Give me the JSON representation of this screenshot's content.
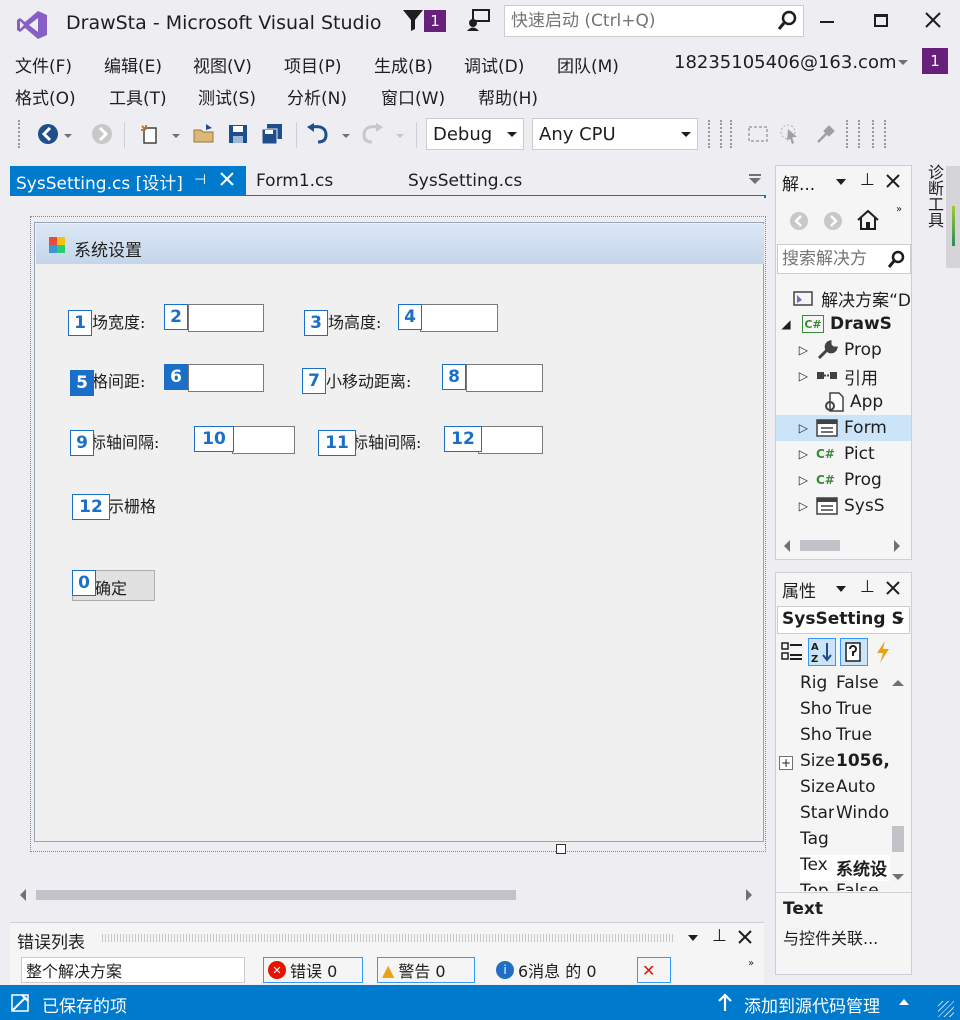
{
  "window": {
    "app_title": "DrawSta - Microsoft Visual Studio",
    "notification_count": "1",
    "quick_launch_placeholder": "快速启动 (Ctrl+Q)"
  },
  "menu_row1": [
    "文件(F)",
    "编辑(E)",
    "视图(V)",
    "项目(P)",
    "生成(B)",
    "调试(D)",
    "团队(M)"
  ],
  "menu_row2": [
    "格式(O)",
    "工具(T)",
    "测试(S)",
    "分析(N)",
    "窗口(W)",
    "帮助(H)"
  ],
  "account": {
    "email": "18235105406@163.com",
    "avatar_label": "1"
  },
  "toolbar": {
    "config": "Debug",
    "platform": "Any CPU"
  },
  "doc_tabs": [
    "SysSetting.cs [设计]",
    "Form1.cs",
    "SysSetting.cs"
  ],
  "form": {
    "title": "系统设置",
    "labels": {
      "l1": "场宽度:",
      "l3": "场高度:",
      "l5": "格间距:",
      "l7": "小移动距离:",
      "l9": "标轴间隔:",
      "l11": "标轴间隔:",
      "l12": "示栅格",
      "ok": "确定"
    },
    "marks": [
      "1",
      "2",
      "3",
      "4",
      "5",
      "6",
      "7",
      "8",
      "9",
      "10",
      "11",
      "12",
      "12",
      "0"
    ]
  },
  "solution_explorer": {
    "title": "解...",
    "search_placeholder": "搜索解决方",
    "items": [
      "解决方案“D",
      "DrawS",
      "Prop",
      "引用",
      "App",
      "Form",
      "Pict",
      "Prog",
      "SysS"
    ]
  },
  "properties": {
    "title": "属性",
    "object": "SysSetting S",
    "rows": [
      {
        "name": "Rig",
        "value": "False"
      },
      {
        "name": "Sho",
        "value": "True"
      },
      {
        "name": "Sho",
        "value": "True"
      },
      {
        "name": "Size",
        "value": "1056,"
      },
      {
        "name": "Size",
        "value": "Auto"
      },
      {
        "name": "Star",
        "value": "Windo"
      },
      {
        "name": "Tag",
        "value": ""
      },
      {
        "name": "Tex",
        "value": "系统设"
      },
      {
        "name": "Top",
        "value": "False"
      }
    ],
    "desc_title": "Text",
    "desc_text": "与控件关联..."
  },
  "diag_tools": "诊断工具",
  "error_list": {
    "title": "错误列表",
    "scope": "整个解决方案",
    "errors": "错误 0",
    "warnings": "警告 0",
    "messages": "6消息 的 0"
  },
  "status": {
    "left": "已保存的项",
    "right": "添加到源代码管理"
  },
  "colors": {
    "accent": "#007acc",
    "vs_purple": "#68217a",
    "marker": "#1a6fc9"
  }
}
